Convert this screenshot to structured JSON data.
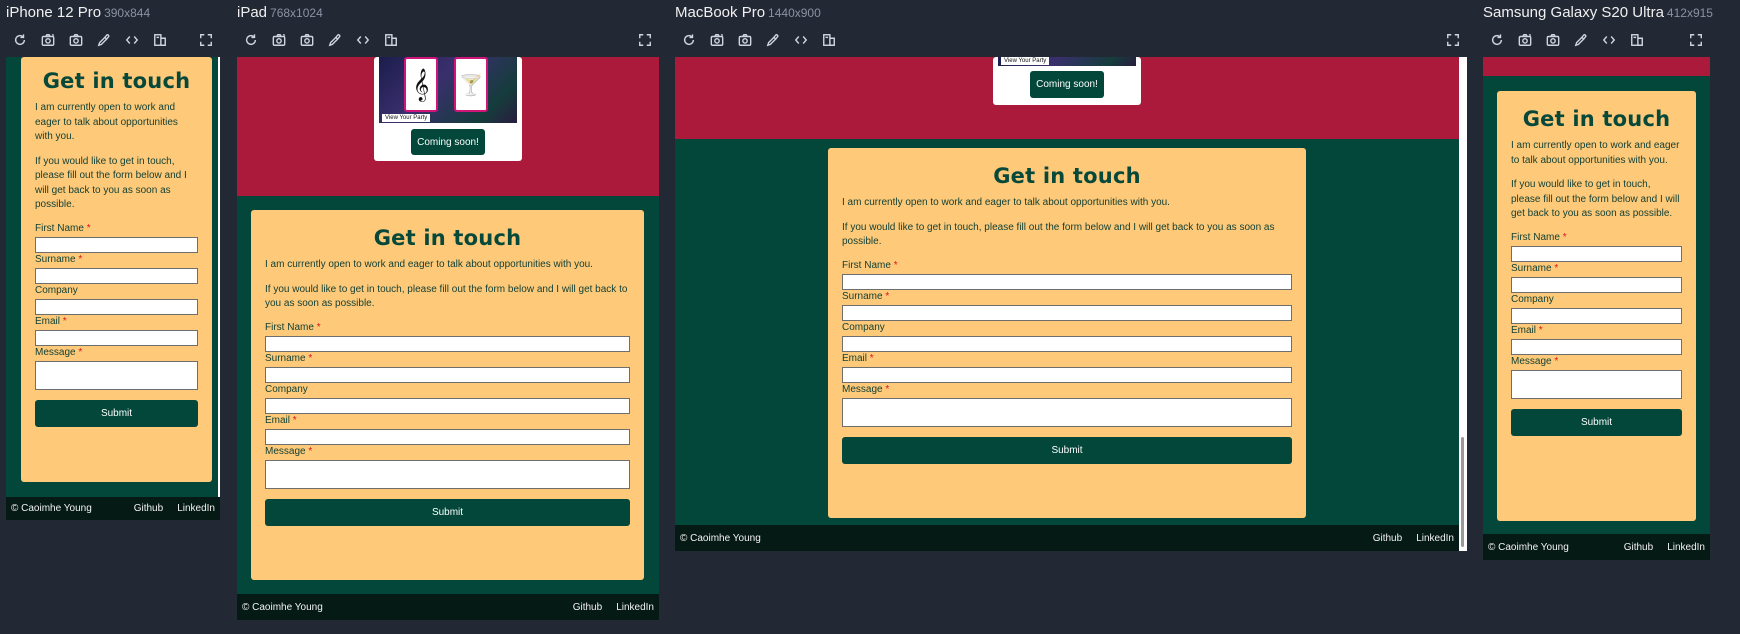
{
  "devices": [
    {
      "name": "iPhone 12 Pro",
      "size": "390x844"
    },
    {
      "name": "iPad",
      "size": "768x1024"
    },
    {
      "name": "MacBook Pro",
      "size": "1440x900"
    },
    {
      "name": "Samsung Galaxy S20 Ultra",
      "size": "412x915"
    }
  ],
  "toolbar_icons": [
    "refresh-icon",
    "camera-rotate-icon",
    "screenshot-icon",
    "eyedropper-icon",
    "code-icon",
    "layout-icon",
    "expand-icon"
  ],
  "projects": {
    "tag": "View Your Party",
    "coming_soon": "Coming soon!",
    "tiles": [
      "𝄞",
      "🍸"
    ]
  },
  "contact": {
    "title": "Get in touch",
    "intro": "I am currently open to work and eager to talk about opportunities with you.",
    "body": "If you would like to get in touch, please fill out the form below and I will get back to you as soon as possible.",
    "fields": [
      {
        "label": "First Name",
        "required": "*"
      },
      {
        "label": "Surname",
        "required": "*"
      },
      {
        "label": "Company",
        "required": ""
      },
      {
        "label": "Email",
        "required": "*"
      },
      {
        "label": "Message",
        "required": "*"
      }
    ],
    "submit": "Submit"
  },
  "footer": {
    "copyright": "© Caoimhe Young",
    "links": [
      "Github",
      "LinkedIn"
    ]
  },
  "colors": {
    "background": "#222834",
    "hero": "#ab1a3b",
    "section": "#02473a",
    "card": "#fec978",
    "footer": "#061a15"
  }
}
